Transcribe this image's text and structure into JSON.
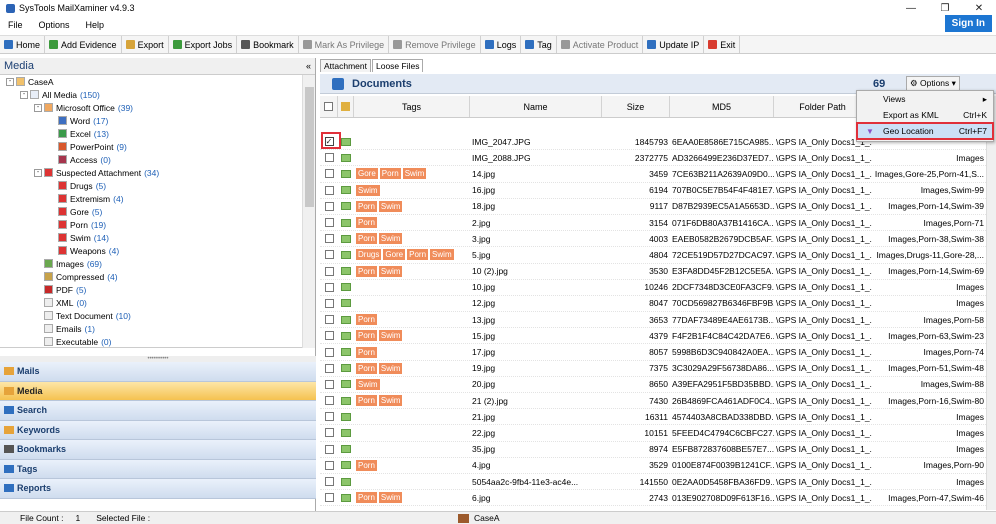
{
  "app": {
    "title": "SysTools MailXaminer v4.9.3",
    "sign_in": "Sign In"
  },
  "menu": [
    "File",
    "Options",
    "Help"
  ],
  "toolbar": [
    {
      "label": "Home",
      "color": "#2f6fbf",
      "disabled": false
    },
    {
      "label": "Add Evidence",
      "color": "#3c9a3c",
      "disabled": false
    },
    {
      "label": "Export",
      "color": "#d7a43a",
      "disabled": false
    },
    {
      "label": "Export Jobs",
      "color": "#3c9a3c",
      "disabled": false
    },
    {
      "label": "Bookmark",
      "color": "#555555",
      "disabled": false
    },
    {
      "label": "Mark As Privilege",
      "color": "#999999",
      "disabled": true
    },
    {
      "label": "Remove Privilege",
      "color": "#999999",
      "disabled": true
    },
    {
      "label": "Logs",
      "color": "#2f6fbf",
      "disabled": false
    },
    {
      "label": "Tag",
      "color": "#2f6fbf",
      "disabled": false
    },
    {
      "label": "Activate Product",
      "color": "#999999",
      "disabled": true
    },
    {
      "label": "Update IP",
      "color": "#2f6fbf",
      "disabled": false
    },
    {
      "label": "Exit",
      "color": "#d83b2f",
      "disabled": false
    }
  ],
  "media_panel": {
    "title": "Media",
    "collapse": "«"
  },
  "tree": [
    {
      "label": "CaseA",
      "count": "",
      "depth": 0,
      "toggle": "-",
      "icon": "case-icon",
      "icolor": "#f1c16b"
    },
    {
      "label": "All Media",
      "count": "(150)",
      "depth": 1,
      "toggle": "-",
      "icon": "media-icon",
      "icolor": "#e8eef8"
    },
    {
      "label": "Microsoft Office",
      "count": "(39)",
      "depth": 2,
      "toggle": "-",
      "icon": "office-icon",
      "icolor": "#f0a860"
    },
    {
      "label": "Word",
      "count": "(17)",
      "depth": 3,
      "toggle": "",
      "icon": "word-icon",
      "icolor": "#3e6fc1"
    },
    {
      "label": "Excel",
      "count": "(13)",
      "depth": 3,
      "toggle": "",
      "icon": "excel-icon",
      "icolor": "#3b9a4a"
    },
    {
      "label": "PowerPoint",
      "count": "(9)",
      "depth": 3,
      "toggle": "",
      "icon": "powerpoint-icon",
      "icolor": "#d8572c"
    },
    {
      "label": "Access",
      "count": "(0)",
      "depth": 3,
      "toggle": "",
      "icon": "access-icon",
      "icolor": "#a6354d"
    },
    {
      "label": "Suspected Attachment",
      "count": "(34)",
      "depth": 2,
      "toggle": "-",
      "icon": "warning-icon",
      "icolor": "#d33"
    },
    {
      "label": "Drugs",
      "count": "(5)",
      "depth": 3,
      "toggle": "",
      "icon": "drugs-icon",
      "icolor": "#d33"
    },
    {
      "label": "Extremism",
      "count": "(4)",
      "depth": 3,
      "toggle": "",
      "icon": "extremism-icon",
      "icolor": "#d33"
    },
    {
      "label": "Gore",
      "count": "(5)",
      "depth": 3,
      "toggle": "",
      "icon": "gore-icon",
      "icolor": "#d33"
    },
    {
      "label": "Porn",
      "count": "(19)",
      "depth": 3,
      "toggle": "",
      "icon": "porn-icon",
      "icolor": "#d33"
    },
    {
      "label": "Swim",
      "count": "(14)",
      "depth": 3,
      "toggle": "",
      "icon": "swim-icon",
      "icolor": "#d33"
    },
    {
      "label": "Weapons",
      "count": "(4)",
      "depth": 3,
      "toggle": "",
      "icon": "weapons-icon",
      "icolor": "#d33"
    },
    {
      "label": "Images",
      "count": "(69)",
      "depth": 2,
      "toggle": "",
      "icon": "images-icon",
      "icolor": "#6aa84f"
    },
    {
      "label": "Compressed",
      "count": "(4)",
      "depth": 2,
      "toggle": "",
      "icon": "compressed-icon",
      "icolor": "#c7a24a"
    },
    {
      "label": "PDF",
      "count": "(5)",
      "depth": 2,
      "toggle": "",
      "icon": "pdf-icon",
      "icolor": "#c62828"
    },
    {
      "label": "XML",
      "count": "(0)",
      "depth": 2,
      "toggle": "",
      "icon": "xml-icon",
      "icolor": "#eeeeee"
    },
    {
      "label": "Text Document",
      "count": "(10)",
      "depth": 2,
      "toggle": "",
      "icon": "text-icon",
      "icolor": "#eeeeee"
    },
    {
      "label": "Emails",
      "count": "(1)",
      "depth": 2,
      "toggle": "",
      "icon": "email-icon",
      "icolor": "#eeeeee"
    },
    {
      "label": "Executable",
      "count": "(0)",
      "depth": 2,
      "toggle": "",
      "icon": "executable-icon",
      "icolor": "#eeeeee"
    }
  ],
  "nav": [
    {
      "label": "Mails",
      "active": false,
      "icon": "mail-icon",
      "icolor": "#e6a33a"
    },
    {
      "label": "Media",
      "active": true,
      "icon": "media-icon",
      "icolor": "#e6a33a"
    },
    {
      "label": "Search",
      "active": false,
      "icon": "search-icon",
      "icolor": "#2f6fbf"
    },
    {
      "label": "Keywords",
      "active": false,
      "icon": "keywords-icon",
      "icolor": "#e6a33a"
    },
    {
      "label": "Bookmarks",
      "active": false,
      "icon": "bookmarks-icon",
      "icolor": "#555555"
    },
    {
      "label": "Tags",
      "active": false,
      "icon": "tags-icon",
      "icolor": "#2f6fbf"
    },
    {
      "label": "Reports",
      "active": false,
      "icon": "reports-icon",
      "icolor": "#2f6fbf"
    }
  ],
  "status": {
    "file_count_label": "File Count :",
    "file_count": "1",
    "selected_label": "Selected File :",
    "case": "CaseA"
  },
  "tabs": [
    "Attachment",
    "Loose Files"
  ],
  "documents": {
    "title": "Documents",
    "count": "69",
    "options_label": "Options"
  },
  "columns": [
    "Tags",
    "Name",
    "Size",
    "MD5",
    "Folder Path"
  ],
  "context_menu": [
    {
      "label": "Views",
      "shortcut": "▸",
      "highlight": false
    },
    {
      "label": "Export as KML",
      "shortcut": "Ctrl+K",
      "highlight": false
    },
    {
      "label": "Geo Location",
      "shortcut": "Ctrl+F7",
      "highlight": true
    }
  ],
  "rows": [
    {
      "checked": true,
      "tags": [],
      "name": "IMG_2047.JPG",
      "size": "1845793",
      "md5": "6EAA0E8586E715CA985...",
      "path": "\\GPS IA_Only Docs1_1_...",
      "ftype": ""
    },
    {
      "checked": false,
      "tags": [],
      "name": "IMG_2088.JPG",
      "size": "2372775",
      "md5": "AD3266499E236D37ED7...",
      "path": "\\GPS IA_Only Docs1_1_...",
      "ftype": "Images"
    },
    {
      "checked": false,
      "tags": [
        "Gore",
        "Porn",
        "Swim"
      ],
      "name": "14.jpg",
      "size": "3459",
      "md5": "7CE63B211A2639A09D0...",
      "path": "\\GPS IA_Only Docs1_1_...",
      "ftype": "Images,Gore-25,Porn-41,S..."
    },
    {
      "checked": false,
      "tags": [
        "Swim"
      ],
      "name": "16.jpg",
      "size": "6194",
      "md5": "707B0C5E7B54F4F481E7...",
      "path": "\\GPS IA_Only Docs1_1_...",
      "ftype": "Images,Swim-99"
    },
    {
      "checked": false,
      "tags": [
        "Porn",
        "Swim"
      ],
      "name": "18.jpg",
      "size": "9117",
      "md5": "D87B2939EC5A1A5653D...",
      "path": "\\GPS IA_Only Docs1_1_...",
      "ftype": "Images,Porn-14,Swim-39"
    },
    {
      "checked": false,
      "tags": [
        "Porn"
      ],
      "name": "2.jpg",
      "size": "3154",
      "md5": "071F6DB80A37B1416CA...",
      "path": "\\GPS IA_Only Docs1_1_...",
      "ftype": "Images,Porn-71"
    },
    {
      "checked": false,
      "tags": [
        "Porn",
        "Swim"
      ],
      "name": "3.jpg",
      "size": "4003",
      "md5": "EAEB0582B2679DCB5AF...",
      "path": "\\GPS IA_Only Docs1_1_...",
      "ftype": "Images,Porn-38,Swim-38"
    },
    {
      "checked": false,
      "tags": [
        "Drugs",
        "Gore",
        "Porn",
        "Swim"
      ],
      "name": "5.jpg",
      "size": "4804",
      "md5": "72CE519D57D27DCAC97...",
      "path": "\\GPS IA_Only Docs1_1_...",
      "ftype": "Images,Drugs-11,Gore-28,..."
    },
    {
      "checked": false,
      "tags": [
        "Porn",
        "Swim"
      ],
      "name": "10 (2).jpg",
      "size": "3530",
      "md5": "E3FA8DD45F2B12C5E5A...",
      "path": "\\GPS IA_Only Docs1_1_...",
      "ftype": "Images,Porn-14,Swim-69"
    },
    {
      "checked": false,
      "tags": [],
      "name": "10.jpg",
      "size": "10246",
      "md5": "2DCF7348D3CE0FA3CF9...",
      "path": "\\GPS IA_Only Docs1_1_...",
      "ftype": "Images"
    },
    {
      "checked": false,
      "tags": [],
      "name": "12.jpg",
      "size": "8047",
      "md5": "70CD569827B6346FBF9B...",
      "path": "\\GPS IA_Only Docs1_1_...",
      "ftype": "Images"
    },
    {
      "checked": false,
      "tags": [
        "Porn"
      ],
      "name": "13.jpg",
      "size": "3653",
      "md5": "77DAF73489E4AE6173B...",
      "path": "\\GPS IA_Only Docs1_1_...",
      "ftype": "Images,Porn-58"
    },
    {
      "checked": false,
      "tags": [
        "Porn",
        "Swim"
      ],
      "name": "15.jpg",
      "size": "4379",
      "md5": "F4F2B1F4C84C42DA7E6...",
      "path": "\\GPS IA_Only Docs1_1_...",
      "ftype": "Images,Porn-63,Swim-23"
    },
    {
      "checked": false,
      "tags": [
        "Porn"
      ],
      "name": "17.jpg",
      "size": "8057",
      "md5": "5998B6D3C940842A0EA...",
      "path": "\\GPS IA_Only Docs1_1_...",
      "ftype": "Images,Porn-74"
    },
    {
      "checked": false,
      "tags": [
        "Porn",
        "Swim"
      ],
      "name": "19.jpg",
      "size": "7375",
      "md5": "3C3029A29F56738DA86...",
      "path": "\\GPS IA_Only Docs1_1_...",
      "ftype": "Images,Porn-51,Swim-48"
    },
    {
      "checked": false,
      "tags": [
        "Swim"
      ],
      "name": "20.jpg",
      "size": "8650",
      "md5": "A39EFA2951F5BD35BBD...",
      "path": "\\GPS IA_Only Docs1_1_...",
      "ftype": "Images,Swim-88"
    },
    {
      "checked": false,
      "tags": [
        "Porn",
        "Swim"
      ],
      "name": "21 (2).jpg",
      "size": "7430",
      "md5": "26B4869FCA461ADF0C4...",
      "path": "\\GPS IA_Only Docs1_1_...",
      "ftype": "Images,Porn-16,Swim-80"
    },
    {
      "checked": false,
      "tags": [],
      "name": "21.jpg",
      "size": "16311",
      "md5": "4574403A8CBAD338DBD...",
      "path": "\\GPS IA_Only Docs1_1_...",
      "ftype": "Images"
    },
    {
      "checked": false,
      "tags": [],
      "name": "22.jpg",
      "size": "10151",
      "md5": "5FEED4C4794C6CBFC27...",
      "path": "\\GPS IA_Only Docs1_1_...",
      "ftype": "Images"
    },
    {
      "checked": false,
      "tags": [],
      "name": "35.jpg",
      "size": "8974",
      "md5": "E5FB872837608BE57E7...",
      "path": "\\GPS IA_Only Docs1_1_...",
      "ftype": "Images"
    },
    {
      "checked": false,
      "tags": [
        "Porn"
      ],
      "name": "4.jpg",
      "size": "3529",
      "md5": "0100E874F0039B1241CF...",
      "path": "\\GPS IA_Only Docs1_1_...",
      "ftype": "Images,Porn-90"
    },
    {
      "checked": false,
      "tags": [],
      "name": "5054aa2c-9fb4-11e3-ac4e...",
      "size": "141550",
      "md5": "0E2AA0D5458FBA36FD9...",
      "path": "\\GPS IA_Only Docs1_1_...",
      "ftype": "Images"
    },
    {
      "checked": false,
      "tags": [
        "Porn",
        "Swim"
      ],
      "name": "6.jpg",
      "size": "2743",
      "md5": "013E902708D09F613F16...",
      "path": "\\GPS IA_Only Docs1_1_...",
      "ftype": "Images,Porn-47,Swim-46"
    }
  ]
}
